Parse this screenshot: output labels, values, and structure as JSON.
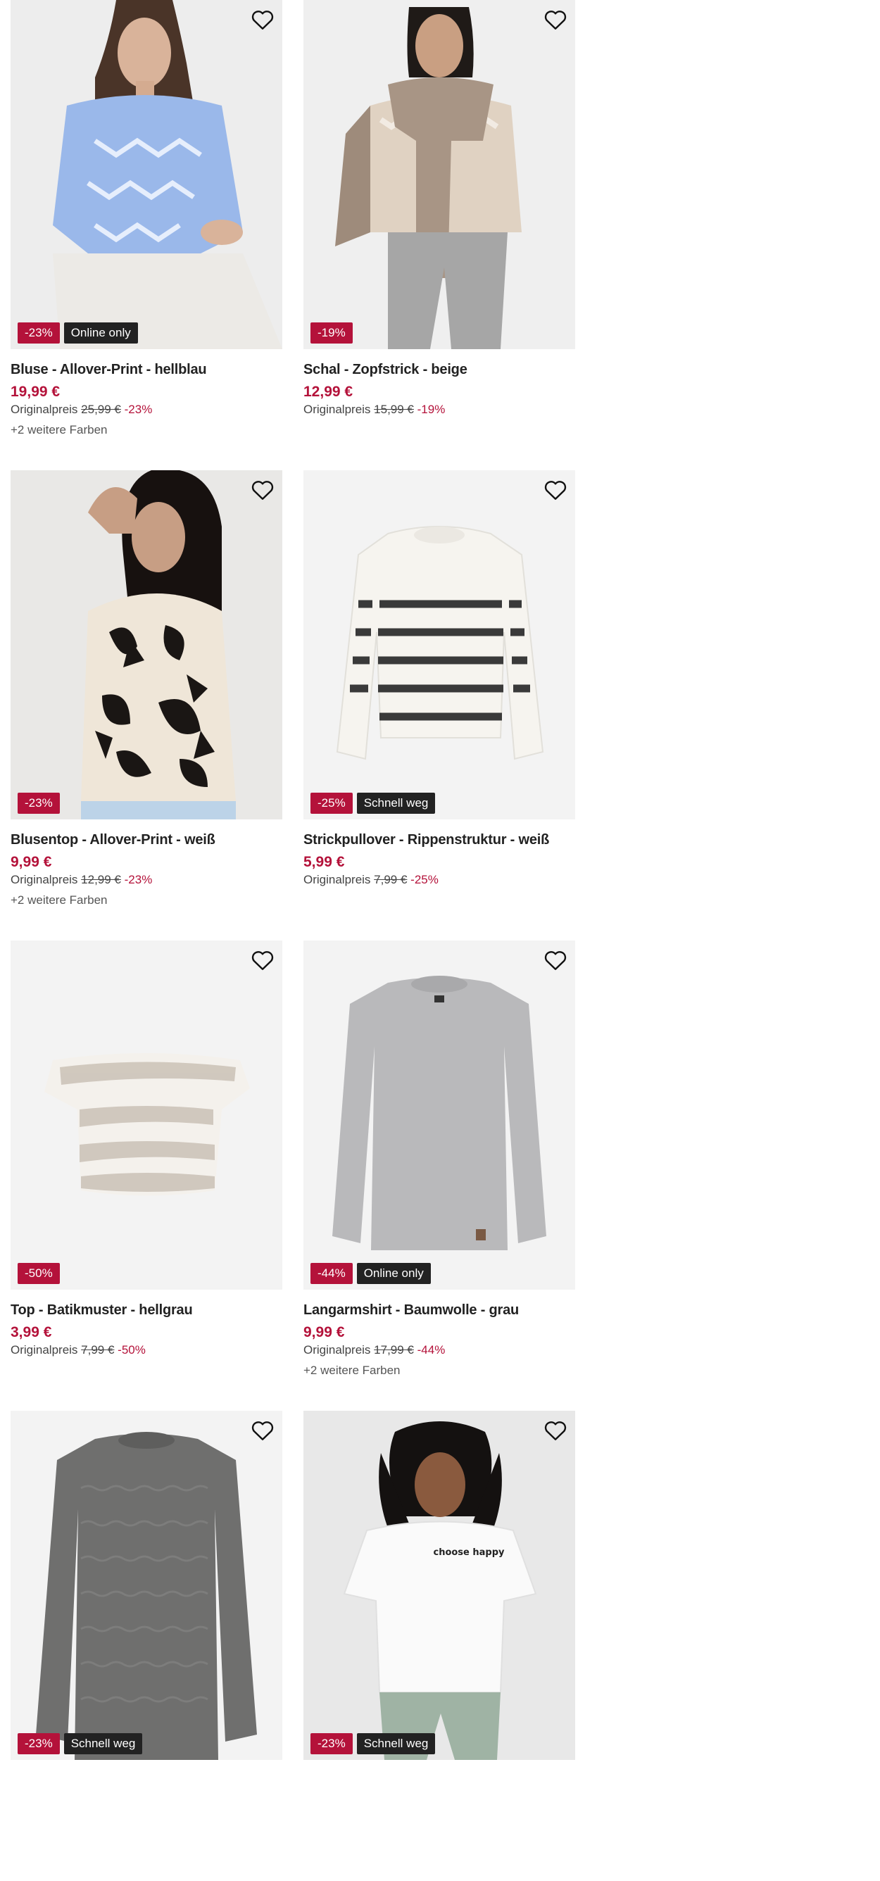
{
  "products": [
    {
      "title": "Bluse - Allover-Print - hellblau",
      "price": "19,99 €",
      "orig_label": "Originalpreis",
      "orig_price": "25,99 €",
      "discount": "-23%",
      "badge_discount": "-23%",
      "badge_info": "Online only",
      "colors": "+2 weitere Farben"
    },
    {
      "title": "Schal - Zopfstrick - beige",
      "price": "12,99 €",
      "orig_label": "Originalpreis",
      "orig_price": "15,99 €",
      "discount": "-19%",
      "badge_discount": "-19%",
      "badge_info": "",
      "colors": ""
    },
    {
      "title": "Blusentop - Allover-Print - weiß",
      "price": "9,99 €",
      "orig_label": "Originalpreis",
      "orig_price": "12,99 €",
      "discount": "-23%",
      "badge_discount": "-23%",
      "badge_info": "",
      "colors": "+2 weitere Farben"
    },
    {
      "title": "Strickpullover - Rippenstruktur - weiß",
      "price": "5,99 €",
      "orig_label": "Originalpreis",
      "orig_price": "7,99 €",
      "discount": "-25%",
      "badge_discount": "-25%",
      "badge_info": "Schnell weg",
      "colors": ""
    },
    {
      "title": "Top - Batikmuster - hellgrau",
      "price": "3,99 €",
      "orig_label": "Originalpreis",
      "orig_price": "7,99 €",
      "discount": "-50%",
      "badge_discount": "-50%",
      "badge_info": "",
      "colors": ""
    },
    {
      "title": "Langarmshirt - Baumwolle - grau",
      "price": "9,99 €",
      "orig_label": "Originalpreis",
      "orig_price": "17,99 €",
      "discount": "-44%",
      "badge_discount": "-44%",
      "badge_info": "Online only",
      "colors": "+2 weitere Farben"
    },
    {
      "title": "",
      "price": "",
      "orig_label": "",
      "orig_price": "",
      "discount": "",
      "badge_discount": "-23%",
      "badge_info": "Schnell weg",
      "colors": ""
    },
    {
      "title": "",
      "price": "",
      "orig_label": "",
      "orig_price": "",
      "discount": "",
      "badge_discount": "-23%",
      "badge_info": "Schnell weg",
      "colors": ""
    }
  ],
  "print_text": "choose happy",
  "colors": {
    "sale": "#b4123a",
    "info_badge": "#222222",
    "image_bg": "#f3f3f3"
  }
}
